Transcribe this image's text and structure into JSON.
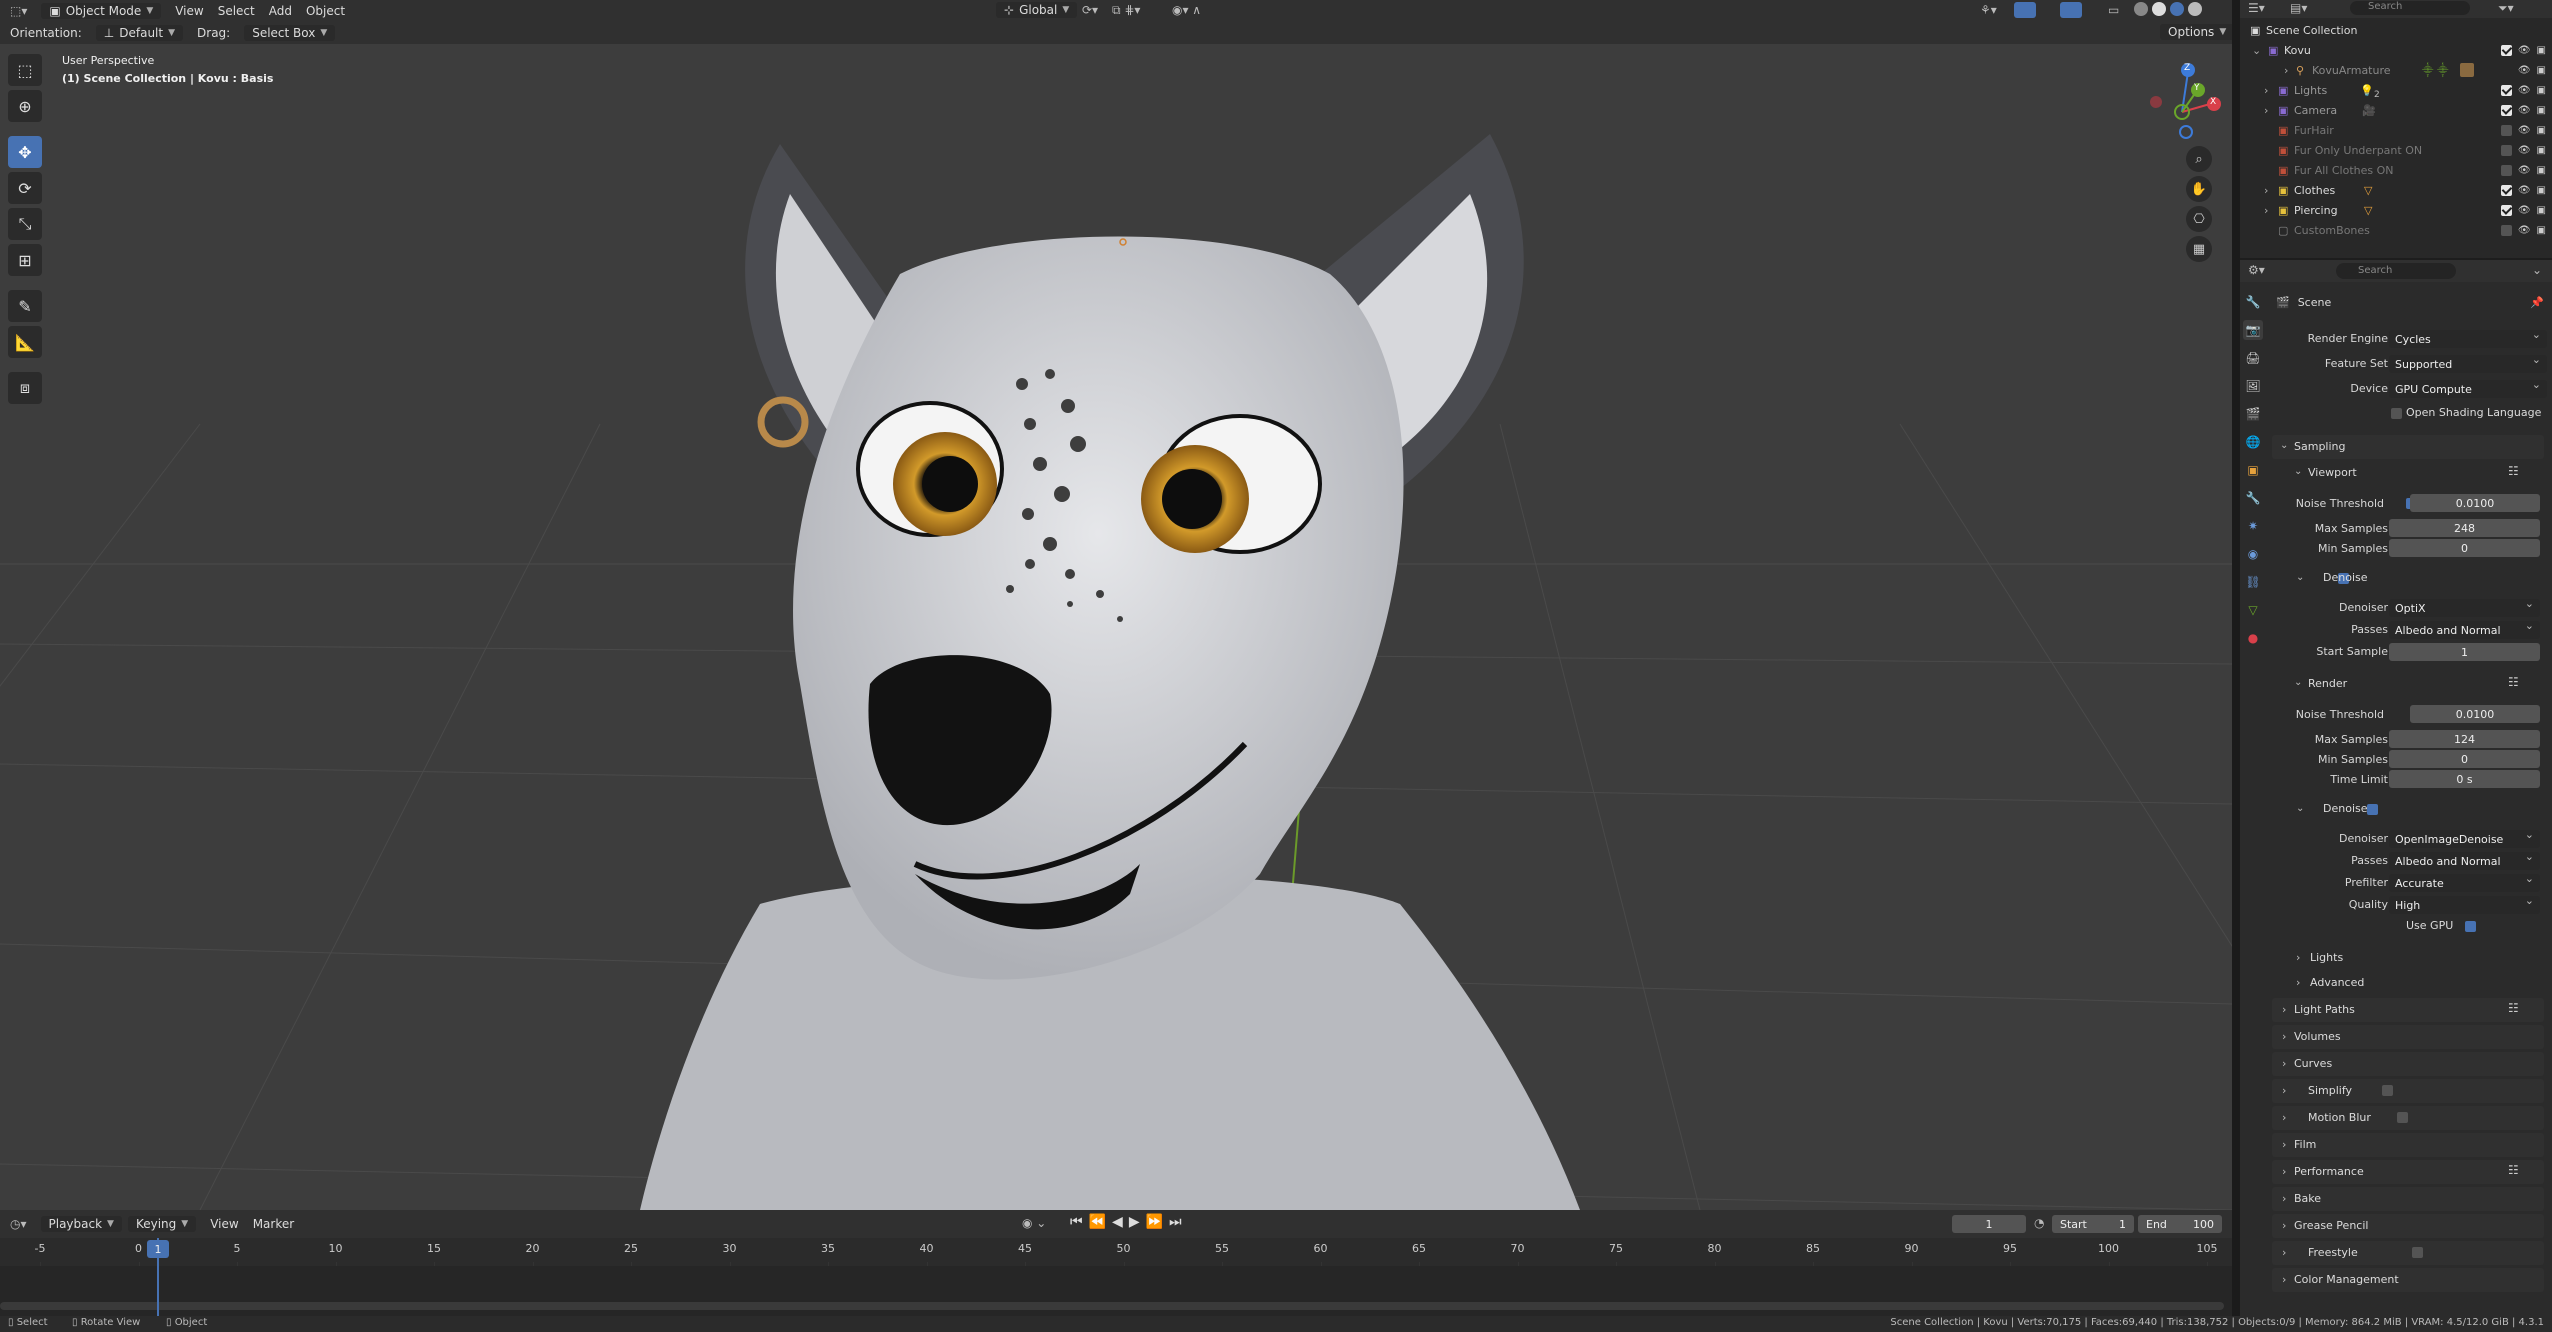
{
  "header": {
    "mode": "Object Mode",
    "menus": [
      "View",
      "Select",
      "Add",
      "Object"
    ],
    "orientation_label": "Orientation:",
    "orientation_value": "Default",
    "drag_label": "Drag:",
    "drag_value": "Select Box",
    "transform_orientation": "Global",
    "options": "Options"
  },
  "viewport": {
    "perspective": "User Perspective",
    "collection_info": "(1) Scene Collection | Kovu : Basis",
    "gizmo_axes": {
      "z": "Z",
      "y": "Y",
      "x": "X"
    }
  },
  "outliner": {
    "search_placeholder": "Search",
    "root": "Scene Collection",
    "items": [
      {
        "name": "Kovu",
        "color": "#8a6bd1"
      },
      {
        "name": "KovuArmature",
        "color": "#d9a15c"
      },
      {
        "name": "Lights",
        "color": "#8a6bd1"
      },
      {
        "name": "Camera",
        "color": "#8a6bd1"
      },
      {
        "name": "FurHair",
        "color": "#c0503a"
      },
      {
        "name": "Fur Only Underpant ON",
        "color": "#c0503a"
      },
      {
        "name": "Fur All Clothes ON",
        "color": "#c0503a"
      },
      {
        "name": "Clothes",
        "color": "#e6c13c"
      },
      {
        "name": "Piercing",
        "color": "#e6c13c"
      },
      {
        "name": "CustomBones",
        "color": "#888888"
      }
    ],
    "lights_count": "2"
  },
  "properties": {
    "search_placeholder": "Search",
    "context": "Scene",
    "render_engine_label": "Render Engine",
    "render_engine": "Cycles",
    "feature_set_label": "Feature Set",
    "feature_set": "Supported",
    "device_label": "Device",
    "device": "GPU Compute",
    "osl_label": "Open Shading Language",
    "sampling": "Sampling",
    "viewport": "Viewport",
    "noise_threshold_label": "Noise Threshold",
    "vp_noise_threshold": "0.0100",
    "max_samples_label": "Max Samples",
    "vp_max_samples": "248",
    "min_samples_label": "Min Samples",
    "vp_min_samples": "0",
    "denoise_label": "Denoise",
    "denoiser_label": "Denoiser",
    "vp_denoiser": "OptiX",
    "passes_label": "Passes",
    "vp_passes": "Albedo and Normal",
    "start_sample_label": "Start Sample",
    "vp_start_sample": "1",
    "render": "Render",
    "r_noise_threshold": "0.0100",
    "r_max_samples": "124",
    "r_min_samples": "0",
    "time_limit_label": "Time Limit",
    "r_time_limit": "0 s",
    "r_denoiser": "OpenImageDenoise",
    "r_passes": "Albedo and Normal",
    "prefilter_label": "Prefilter",
    "r_prefilter": "Accurate",
    "quality_label": "Quality",
    "r_quality": "High",
    "use_gpu_label": "Use GPU",
    "sub_lights": "Lights",
    "sub_advanced": "Advanced",
    "panels": [
      "Light Paths",
      "Volumes",
      "Curves",
      "Simplify",
      "Motion Blur",
      "Film",
      "Performance",
      "Bake",
      "Grease Pencil",
      "Freestyle",
      "Color Management"
    ]
  },
  "timeline": {
    "menus": [
      "Playback",
      "Keying",
      "View",
      "Marker"
    ],
    "current_frame": "1",
    "start_label": "Start",
    "start": "1",
    "end_label": "End",
    "end": "100",
    "ticks": [
      "-5",
      "0",
      "5",
      "10",
      "15",
      "20",
      "25",
      "30",
      "35",
      "40",
      "45",
      "50",
      "55",
      "60",
      "65",
      "70",
      "75",
      "80",
      "85",
      "90",
      "95",
      "100",
      "105"
    ],
    "playhead": "1"
  },
  "statusbar": {
    "select": "Select",
    "rotate": "Rotate View",
    "object": "Object",
    "stats": "Scene Collection | Kovu | Verts:70,175 | Faces:69,440 | Tris:138,752 | Objects:0/9 | Memory: 864.2 MiB | VRAM: 4.5/12.0 GiB | 4.3.1"
  }
}
